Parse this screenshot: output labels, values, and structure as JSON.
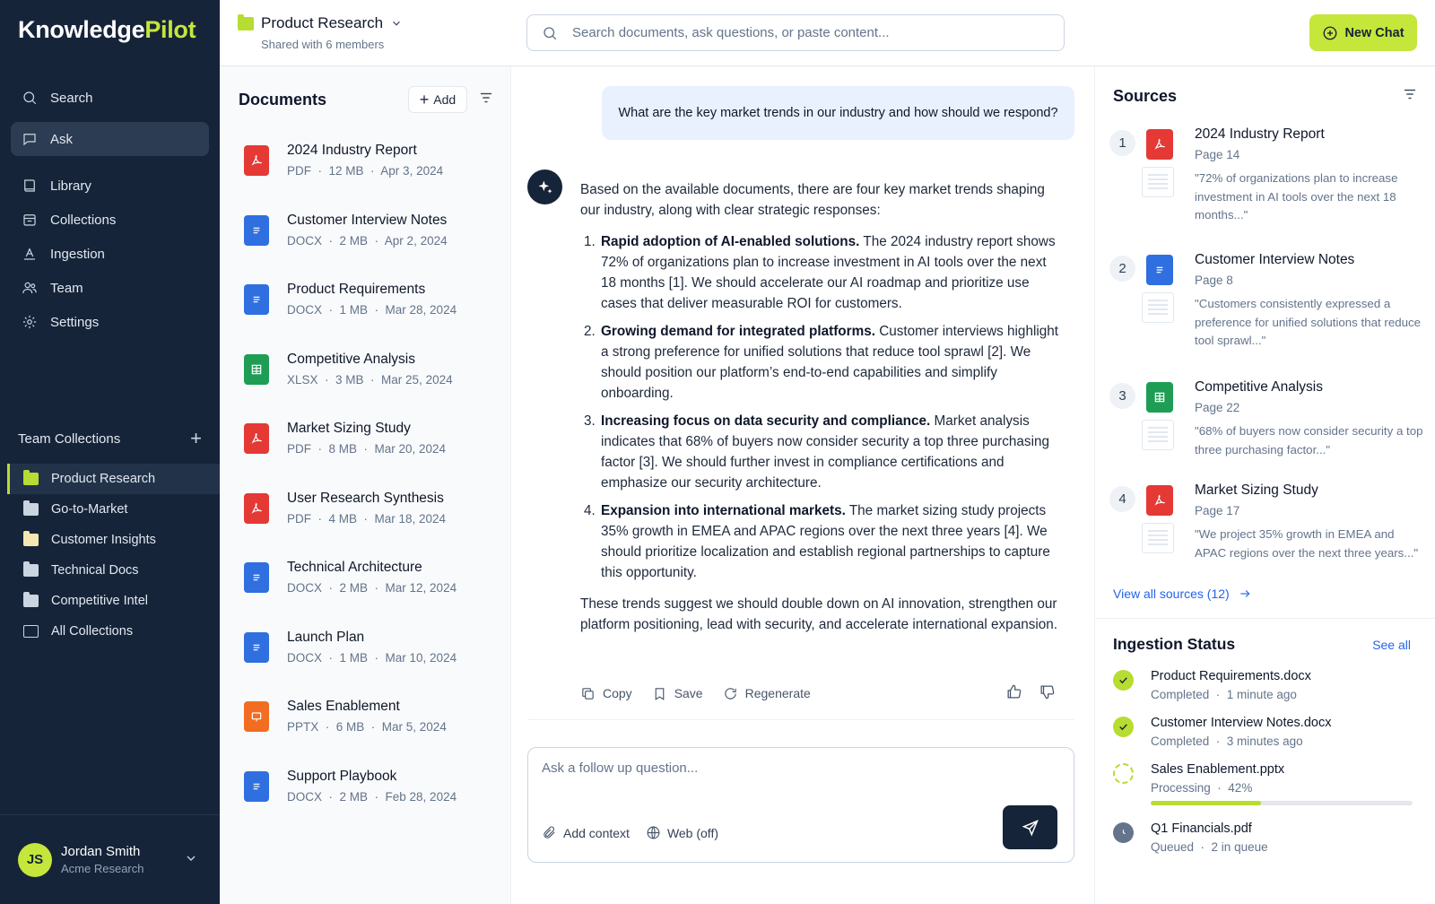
{
  "app": {
    "logo_main": "Knowledge",
    "logo_accent": "Pilot"
  },
  "nav": [
    {
      "label": "Search",
      "icon": "search-icon"
    },
    {
      "label": "Ask",
      "icon": "chat-icon",
      "active": true
    },
    {
      "label": "Library",
      "icon": "book-icon"
    },
    {
      "label": "Collections",
      "icon": "collections-icon"
    },
    {
      "label": "Ingestion",
      "icon": "ingestion-icon"
    },
    {
      "label": "Team",
      "icon": "team-icon"
    },
    {
      "label": "Settings",
      "icon": "gear-icon"
    }
  ],
  "team_collections": {
    "title": "Team Collections",
    "items": [
      {
        "label": "Product Research",
        "active": true
      },
      {
        "label": "Go-to-Market"
      },
      {
        "label": "Customer Insights"
      },
      {
        "label": "Technical Docs"
      },
      {
        "label": "Competitive Intel"
      },
      {
        "label": "All Collections"
      }
    ]
  },
  "user": {
    "initials": "JS",
    "name": "Jordan Smith",
    "org": "Acme Research"
  },
  "header": {
    "project": "Product Research",
    "shared": "Shared with 6 members",
    "search_placeholder": "Search documents, ask questions, or paste content...",
    "new_chat": "New Chat"
  },
  "documents": {
    "title": "Documents",
    "add_label": "Add",
    "items": [
      {
        "name": "2024 Industry Report",
        "type": "PDF",
        "size": "12 MB",
        "date": "Apr 3, 2024"
      },
      {
        "name": "Customer Interview Notes",
        "type": "DOCX",
        "size": "2 MB",
        "date": "Apr 2, 2024"
      },
      {
        "name": "Product Requirements",
        "type": "DOCX",
        "size": "1 MB",
        "date": "Mar 28, 2024"
      },
      {
        "name": "Competitive Analysis",
        "type": "XLSX",
        "size": "3 MB",
        "date": "Mar 25, 2024"
      },
      {
        "name": "Market Sizing Study",
        "type": "PDF",
        "size": "8 MB",
        "date": "Mar 20, 2024"
      },
      {
        "name": "User Research Synthesis",
        "type": "PDF",
        "size": "4 MB",
        "date": "Mar 18, 2024"
      },
      {
        "name": "Technical Architecture",
        "type": "DOCX",
        "size": "2 MB",
        "date": "Mar 12, 2024"
      },
      {
        "name": "Launch Plan",
        "type": "DOCX",
        "size": "1 MB",
        "date": "Mar 10, 2024"
      },
      {
        "name": "Sales Enablement",
        "type": "PPTX",
        "size": "6 MB",
        "date": "Mar 5, 2024"
      },
      {
        "name": "Support Playbook",
        "type": "DOCX",
        "size": "2 MB",
        "date": "Feb 28, 2024"
      }
    ]
  },
  "chat": {
    "question": "What are the key market trends in our industry and how should we respond?",
    "intro": "Based on the available documents, there are four key market trends shaping our industry, along with clear strategic responses:",
    "points": [
      {
        "title": "Rapid adoption of AI-enabled solutions.",
        "text": " The 2024 industry report shows 72% of organizations plan to increase investment in AI tools over the next 18 months [1]. We should accelerate our AI roadmap and prioritize use cases that deliver measurable ROI for customers."
      },
      {
        "title": "Growing demand for integrated platforms.",
        "text": " Customer interviews highlight a strong preference for unified solutions that reduce tool sprawl [2]. We should position our platform’s end-to-end capabilities and simplify onboarding."
      },
      {
        "title": "Increasing focus on data security and compliance.",
        "text": " Market analysis indicates that 68% of buyers now consider security a top three purchasing factor [3]. We should further invest in compliance certifications and emphasize our security architecture."
      },
      {
        "title": "Expansion into international markets.",
        "text": " The market sizing study projects 35% growth in EMEA and APAC regions over the next three years [4]. We should prioritize localization and establish regional partnerships to capture this opportunity."
      }
    ],
    "closing": "These trends suggest we should double down on AI innovation, strengthen our platform positioning, lead with security, and accelerate international expansion.",
    "actions": {
      "copy": "Copy",
      "save": "Save",
      "regenerate": "Regenerate"
    },
    "composer_placeholder": "Ask a follow up question...",
    "add_context": "Add context",
    "web": "Web (off)"
  },
  "sources": {
    "title": "Sources",
    "items": [
      {
        "num": "1",
        "type": "PDF",
        "name": "2024 Industry Report",
        "page": "Page 14",
        "quote": "\"72% of organizations plan to increase investment in AI tools over the next 18 months...\""
      },
      {
        "num": "2",
        "type": "DOCX",
        "name": "Customer Interview Notes",
        "page": "Page 8",
        "quote": "\"Customers consistently expressed a preference for unified solutions that reduce tool sprawl...\""
      },
      {
        "num": "3",
        "type": "XLSX",
        "name": "Competitive Analysis",
        "page": "Page 22",
        "quote": "\"68% of buyers now consider security a top three purchasing factor...\""
      },
      {
        "num": "4",
        "type": "PDF",
        "name": "Market Sizing Study",
        "page": "Page 17",
        "quote": "\"We project 35% growth in EMEA and APAC regions over the next three years...\""
      }
    ],
    "view_all": "View all sources (12)"
  },
  "ingestion": {
    "title": "Ingestion Status",
    "see_all": "See all",
    "items": [
      {
        "name": "Product Requirements.docx",
        "status": "Completed",
        "detail": "1 minute ago",
        "state": "done"
      },
      {
        "name": "Customer Interview Notes.docx",
        "status": "Completed",
        "detail": "3 minutes ago",
        "state": "done"
      },
      {
        "name": "Sales Enablement.pptx",
        "status": "Processing",
        "detail": "42%",
        "state": "processing",
        "progress": 0.42
      },
      {
        "name": "Q1 Financials.pdf",
        "status": "Queued",
        "detail": "2 in queue",
        "state": "queued"
      }
    ]
  },
  "colors": {
    "sidebar_bg": "#152439",
    "accent": "#c5e63a",
    "link": "#2563eb",
    "pdf": "#e53935",
    "docx": "#2f6fe0",
    "xlsx": "#1f9d55",
    "pptx": "#f26d21"
  }
}
